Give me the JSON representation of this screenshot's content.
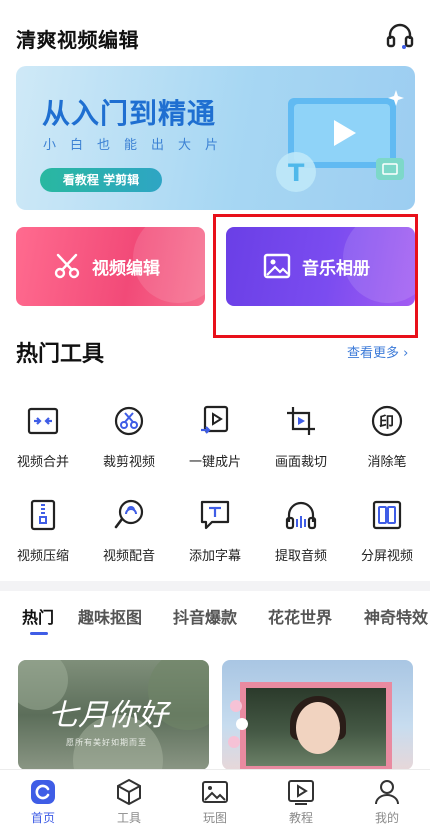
{
  "app": {
    "title": "清爽视频编辑"
  },
  "banner": {
    "title": "从入门到精通",
    "subtitle": "小白也能出大片",
    "button": "看教程 学剪辑",
    "page_count": 2,
    "active_page": 2
  },
  "cards": [
    {
      "label": "视频编辑",
      "icon": "scissors-icon",
      "color": "#f24a78"
    },
    {
      "label": "音乐相册",
      "icon": "image-icon",
      "color": "#7b4cf0"
    }
  ],
  "hot_tools": {
    "title": "热门工具",
    "see_more": "查看更多",
    "items": [
      {
        "label": "视频合并",
        "icon": "merge-icon"
      },
      {
        "label": "裁剪视频",
        "icon": "crop-video-icon"
      },
      {
        "label": "一键成片",
        "icon": "one-click-icon"
      },
      {
        "label": "画面裁切",
        "icon": "frame-crop-icon"
      },
      {
        "label": "消除笔",
        "icon": "eraser-icon"
      },
      {
        "label": "视频压缩",
        "icon": "compress-icon"
      },
      {
        "label": "视频配音",
        "icon": "dubbing-icon"
      },
      {
        "label": "添加字幕",
        "icon": "subtitle-icon"
      },
      {
        "label": "提取音频",
        "icon": "extract-audio-icon"
      },
      {
        "label": "分屏视频",
        "icon": "split-screen-icon"
      }
    ]
  },
  "tabs": [
    "热门",
    "趣味抠图",
    "抖音爆款",
    "花花世界",
    "神奇特效"
  ],
  "active_tab": 0,
  "thumbnails": [
    {
      "text": "七月你好",
      "caption": "愿所有美好如期而至"
    },
    {
      "text": ""
    }
  ],
  "bottom_nav": [
    {
      "label": "首页",
      "icon": "home-icon",
      "active": true
    },
    {
      "label": "工具",
      "icon": "tools-icon",
      "active": false
    },
    {
      "label": "玩图",
      "icon": "picture-icon",
      "active": false
    },
    {
      "label": "教程",
      "icon": "tutorial-icon",
      "active": false
    },
    {
      "label": "我的",
      "icon": "profile-icon",
      "active": false
    }
  ],
  "colors": {
    "accent": "#3f5de6",
    "highlight": "#e8101a",
    "banner_title": "#1f6fd1"
  }
}
